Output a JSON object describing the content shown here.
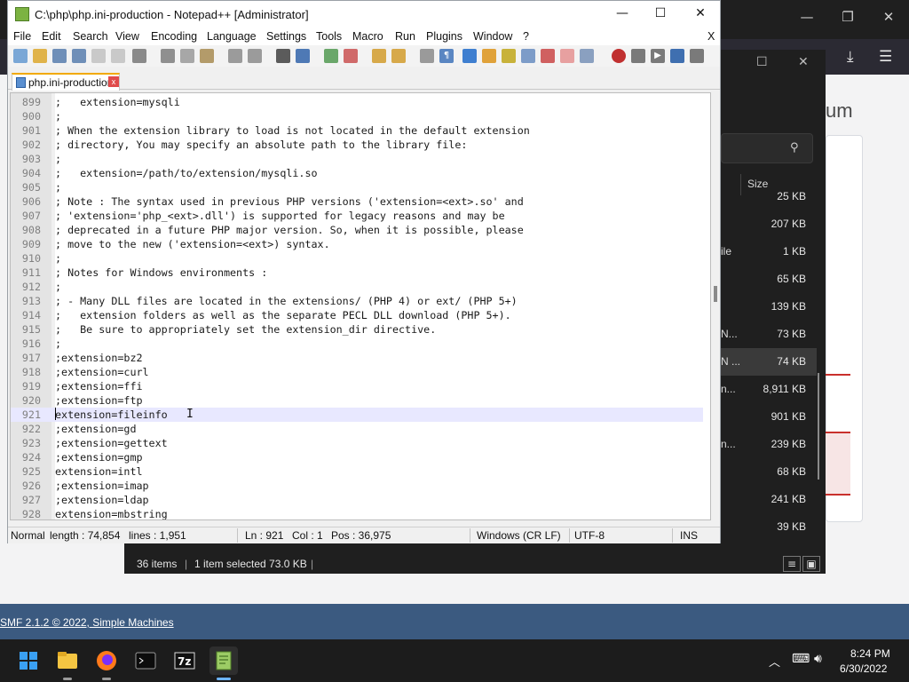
{
  "browser": {
    "heading_fragment": "um",
    "footer_link": "SMF 2.1.2 © 2022, Simple Machines"
  },
  "explorer": {
    "size_header": "Size",
    "rows": [
      {
        "name": "",
        "size": "25 KB"
      },
      {
        "name": "",
        "size": "207 KB"
      },
      {
        "name": "ile",
        "size": "1 KB"
      },
      {
        "name": "",
        "size": "65 KB"
      },
      {
        "name": "",
        "size": "139 KB"
      },
      {
        "name": "N...",
        "size": "73 KB"
      },
      {
        "name": "N ...",
        "size": "74 KB",
        "selected": true
      },
      {
        "name": "n...",
        "size": "8,911 KB"
      },
      {
        "name": "",
        "size": "901 KB"
      },
      {
        "name": "n...",
        "size": "239 KB"
      },
      {
        "name": "",
        "size": "68 KB"
      },
      {
        "name": "",
        "size": "241 KB"
      },
      {
        "name": "",
        "size": "39 KB"
      }
    ],
    "status_items": "36 items",
    "status_selected": "1 item selected  73.0 KB"
  },
  "npp": {
    "title": "C:\\php\\php.ini-production - Notepad++ [Administrator]",
    "menu": [
      "File",
      "Edit",
      "Search",
      "View",
      "Encoding",
      "Language",
      "Settings",
      "Tools",
      "Macro",
      "Run",
      "Plugins",
      "Window",
      "?"
    ],
    "menu_close": "X",
    "tab_label": "php.ini-production",
    "tab_close": "x",
    "lines": [
      {
        "n": "899",
        "t": ";   extension=mysqli"
      },
      {
        "n": "900",
        "t": ";"
      },
      {
        "n": "901",
        "t": "; When the extension library to load is not located in the default extension"
      },
      {
        "n": "902",
        "t": "; directory, You may specify an absolute path to the library file:"
      },
      {
        "n": "903",
        "t": ";"
      },
      {
        "n": "904",
        "t": ";   extension=/path/to/extension/mysqli.so"
      },
      {
        "n": "905",
        "t": ";"
      },
      {
        "n": "906",
        "t": "; Note : The syntax used in previous PHP versions ('extension=<ext>.so' and"
      },
      {
        "n": "907",
        "t": "; 'extension='php_<ext>.dll') is supported for legacy reasons and may be"
      },
      {
        "n": "908",
        "t": "; deprecated in a future PHP major version. So, when it is possible, please"
      },
      {
        "n": "909",
        "t": "; move to the new ('extension=<ext>) syntax."
      },
      {
        "n": "910",
        "t": ";"
      },
      {
        "n": "911",
        "t": "; Notes for Windows environments :"
      },
      {
        "n": "912",
        "t": ";"
      },
      {
        "n": "913",
        "t": "; - Many DLL files are located in the extensions/ (PHP 4) or ext/ (PHP 5+)"
      },
      {
        "n": "914",
        "t": ";   extension folders as well as the separate PECL DLL download (PHP 5+)."
      },
      {
        "n": "915",
        "t": ";   Be sure to appropriately set the extension_dir directive."
      },
      {
        "n": "916",
        "t": ";"
      },
      {
        "n": "917",
        "t": ";extension=bz2"
      },
      {
        "n": "918",
        "t": ";extension=curl"
      },
      {
        "n": "919",
        "t": ";extension=ffi"
      },
      {
        "n": "920",
        "t": ";extension=ftp"
      },
      {
        "n": "921",
        "t": "extension=fileinfo",
        "current": true
      },
      {
        "n": "922",
        "t": ";extension=gd"
      },
      {
        "n": "923",
        "t": ";extension=gettext"
      },
      {
        "n": "924",
        "t": ";extension=gmp"
      },
      {
        "n": "925",
        "t": "extension=intl"
      },
      {
        "n": "926",
        "t": ";extension=imap"
      },
      {
        "n": "927",
        "t": ";extension=ldap"
      },
      {
        "n": "928",
        "t": "extension=mbstring"
      }
    ],
    "status": {
      "mode": "Normal",
      "length": "length : 74,854",
      "lines": "lines : 1,951",
      "ln": "Ln : 921",
      "col": "Col : 1",
      "pos": "Pos : 36,975",
      "eol": "Windows (CR LF)",
      "encoding": "UTF-8",
      "ins": "INS"
    }
  },
  "taskbar": {
    "time": "8:24 PM",
    "date": "6/30/2022"
  },
  "colors": {
    "current_line": "#e8e8ff",
    "taskbar": "#1c1c1c",
    "forum_footer": "#3b5a80"
  }
}
